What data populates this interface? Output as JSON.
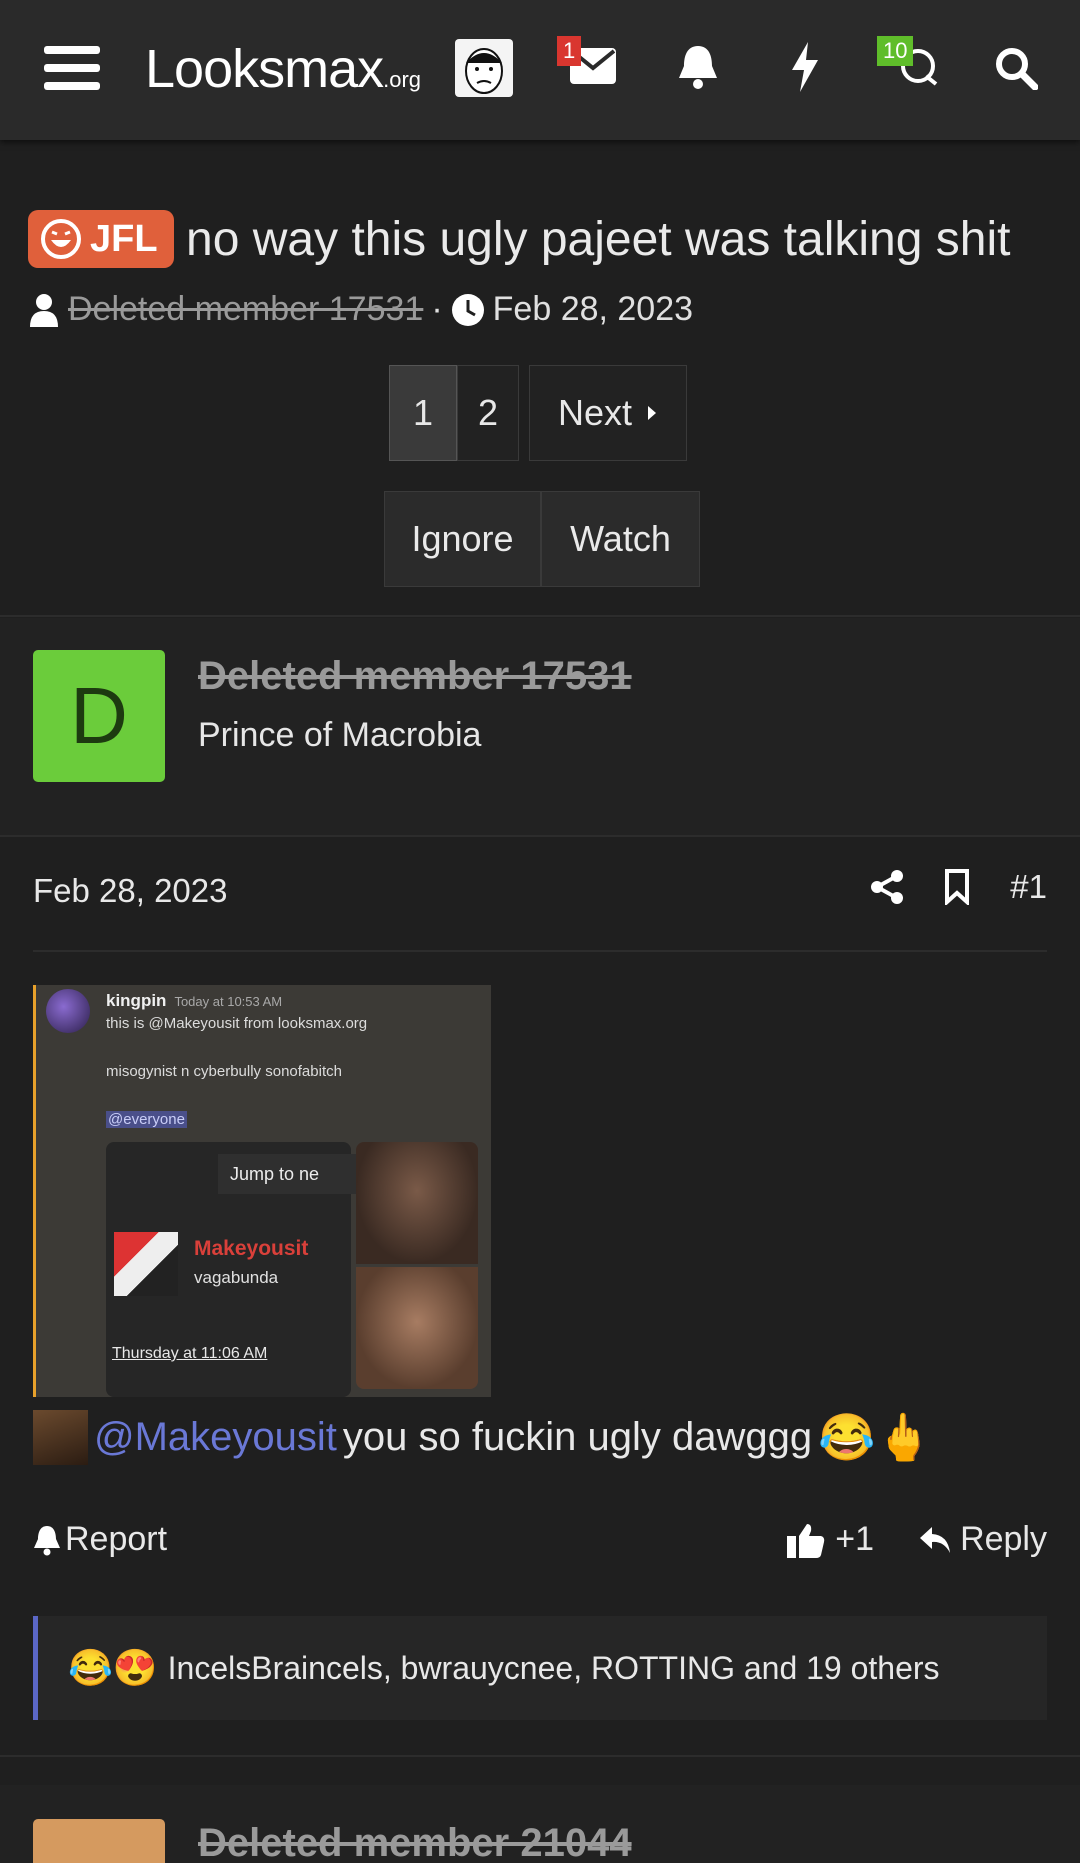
{
  "topbar": {
    "logo_main": "Looksmax",
    "logo_suffix": ".org",
    "messages_badge": "1",
    "conversations_badge": "10",
    "icons": [
      "menu-icon",
      "avatar",
      "envelope-icon",
      "bell-icon",
      "lightning-icon",
      "chat-icon",
      "search-icon"
    ]
  },
  "thread": {
    "prefix": "JFL",
    "title": "no way this ugly pajeet was talking shit",
    "author": "Deleted member 17531",
    "date": "Feb 28, 2023"
  },
  "pagination": {
    "page1": "1",
    "page2": "2",
    "next": "Next"
  },
  "thread_actions": {
    "ignore": "Ignore",
    "watch": "Watch"
  },
  "post": {
    "avatar_letter": "D",
    "username": "Deleted member 17531",
    "user_title": "Prince of Macrobia",
    "date": "Feb 28, 2023",
    "number": "#1",
    "embed": {
      "author": "kingpin",
      "time": "Today at 10:53 AM",
      "line1": "this is @Makeyousit from looksmax.org",
      "line2": "misogynist n cyberbully sonofabitch",
      "mention": "@everyone",
      "jump": "Jump to ne",
      "card_name": "Makeyousit",
      "card_sub": "vagabunda",
      "card_time": "Thursday at 11:06 AM"
    },
    "mention": "@Makeyousit",
    "text": "you so fuckin ugly dawggg",
    "emoji": "😂🖕",
    "report": "Report",
    "like_count": "+1",
    "reply": "Reply",
    "reaction_emojis": "😂😍",
    "reaction_text": "IncelsBraincels, bwrauycnee, ROTTING and 19 others"
  },
  "next_post": {
    "username": "Deleted member 21044"
  }
}
